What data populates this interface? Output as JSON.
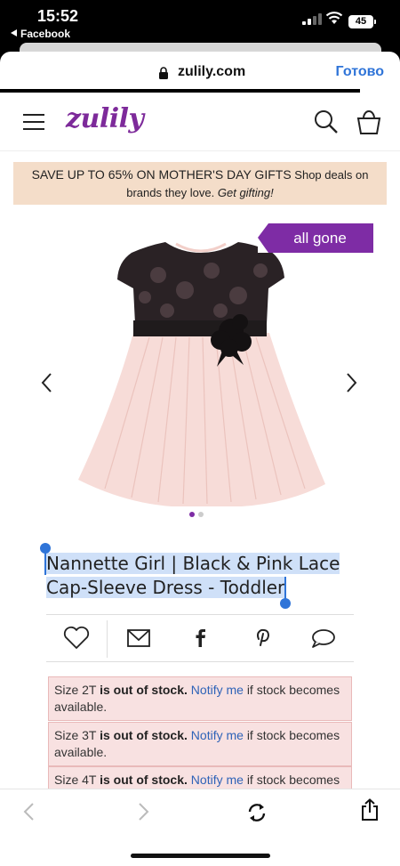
{
  "status_bar": {
    "time": "15:52",
    "back_app": "Facebook",
    "battery": "45"
  },
  "browser": {
    "url": "zulily.com",
    "done_label": "Готово"
  },
  "site": {
    "logo": "zulily"
  },
  "promo": {
    "headline": "SAVE UP TO 65% ON MOTHER'S DAY GIFTS",
    "text": "Shop deals on brands they love.",
    "cta": "Get gifting!"
  },
  "product": {
    "badge": "all gone",
    "title_line1": "Nannette Girl | Black & Pink Lace",
    "title_line2": "Cap-Sleeve Dress - Toddler",
    "image_count": 2,
    "active_image": 1
  },
  "stock_notices": [
    {
      "prefix": "Size 2T",
      "status": "is out of stock.",
      "link": "Notify me",
      "suffix": "if stock becomes available."
    },
    {
      "prefix": "Size 3T",
      "status": "is out of stock.",
      "link": "Notify me",
      "suffix": "if stock becomes available."
    },
    {
      "prefix": "Size 4T",
      "status": "is out of stock.",
      "link": "Notify me",
      "suffix": "if stock becomes"
    }
  ],
  "icons": {
    "share": [
      "heart-icon",
      "mail-icon",
      "facebook-icon",
      "pinterest-icon",
      "comment-icon"
    ],
    "toolbar": [
      "back-icon",
      "forward-icon",
      "reload-icon",
      "share-icon"
    ]
  },
  "colors": {
    "brand_purple": "#7e2ca5",
    "promo_bg": "#f4ddc9",
    "notice_bg": "#f8e1e1",
    "link_blue": "#2f63b8",
    "ios_blue": "#2f74d8"
  }
}
